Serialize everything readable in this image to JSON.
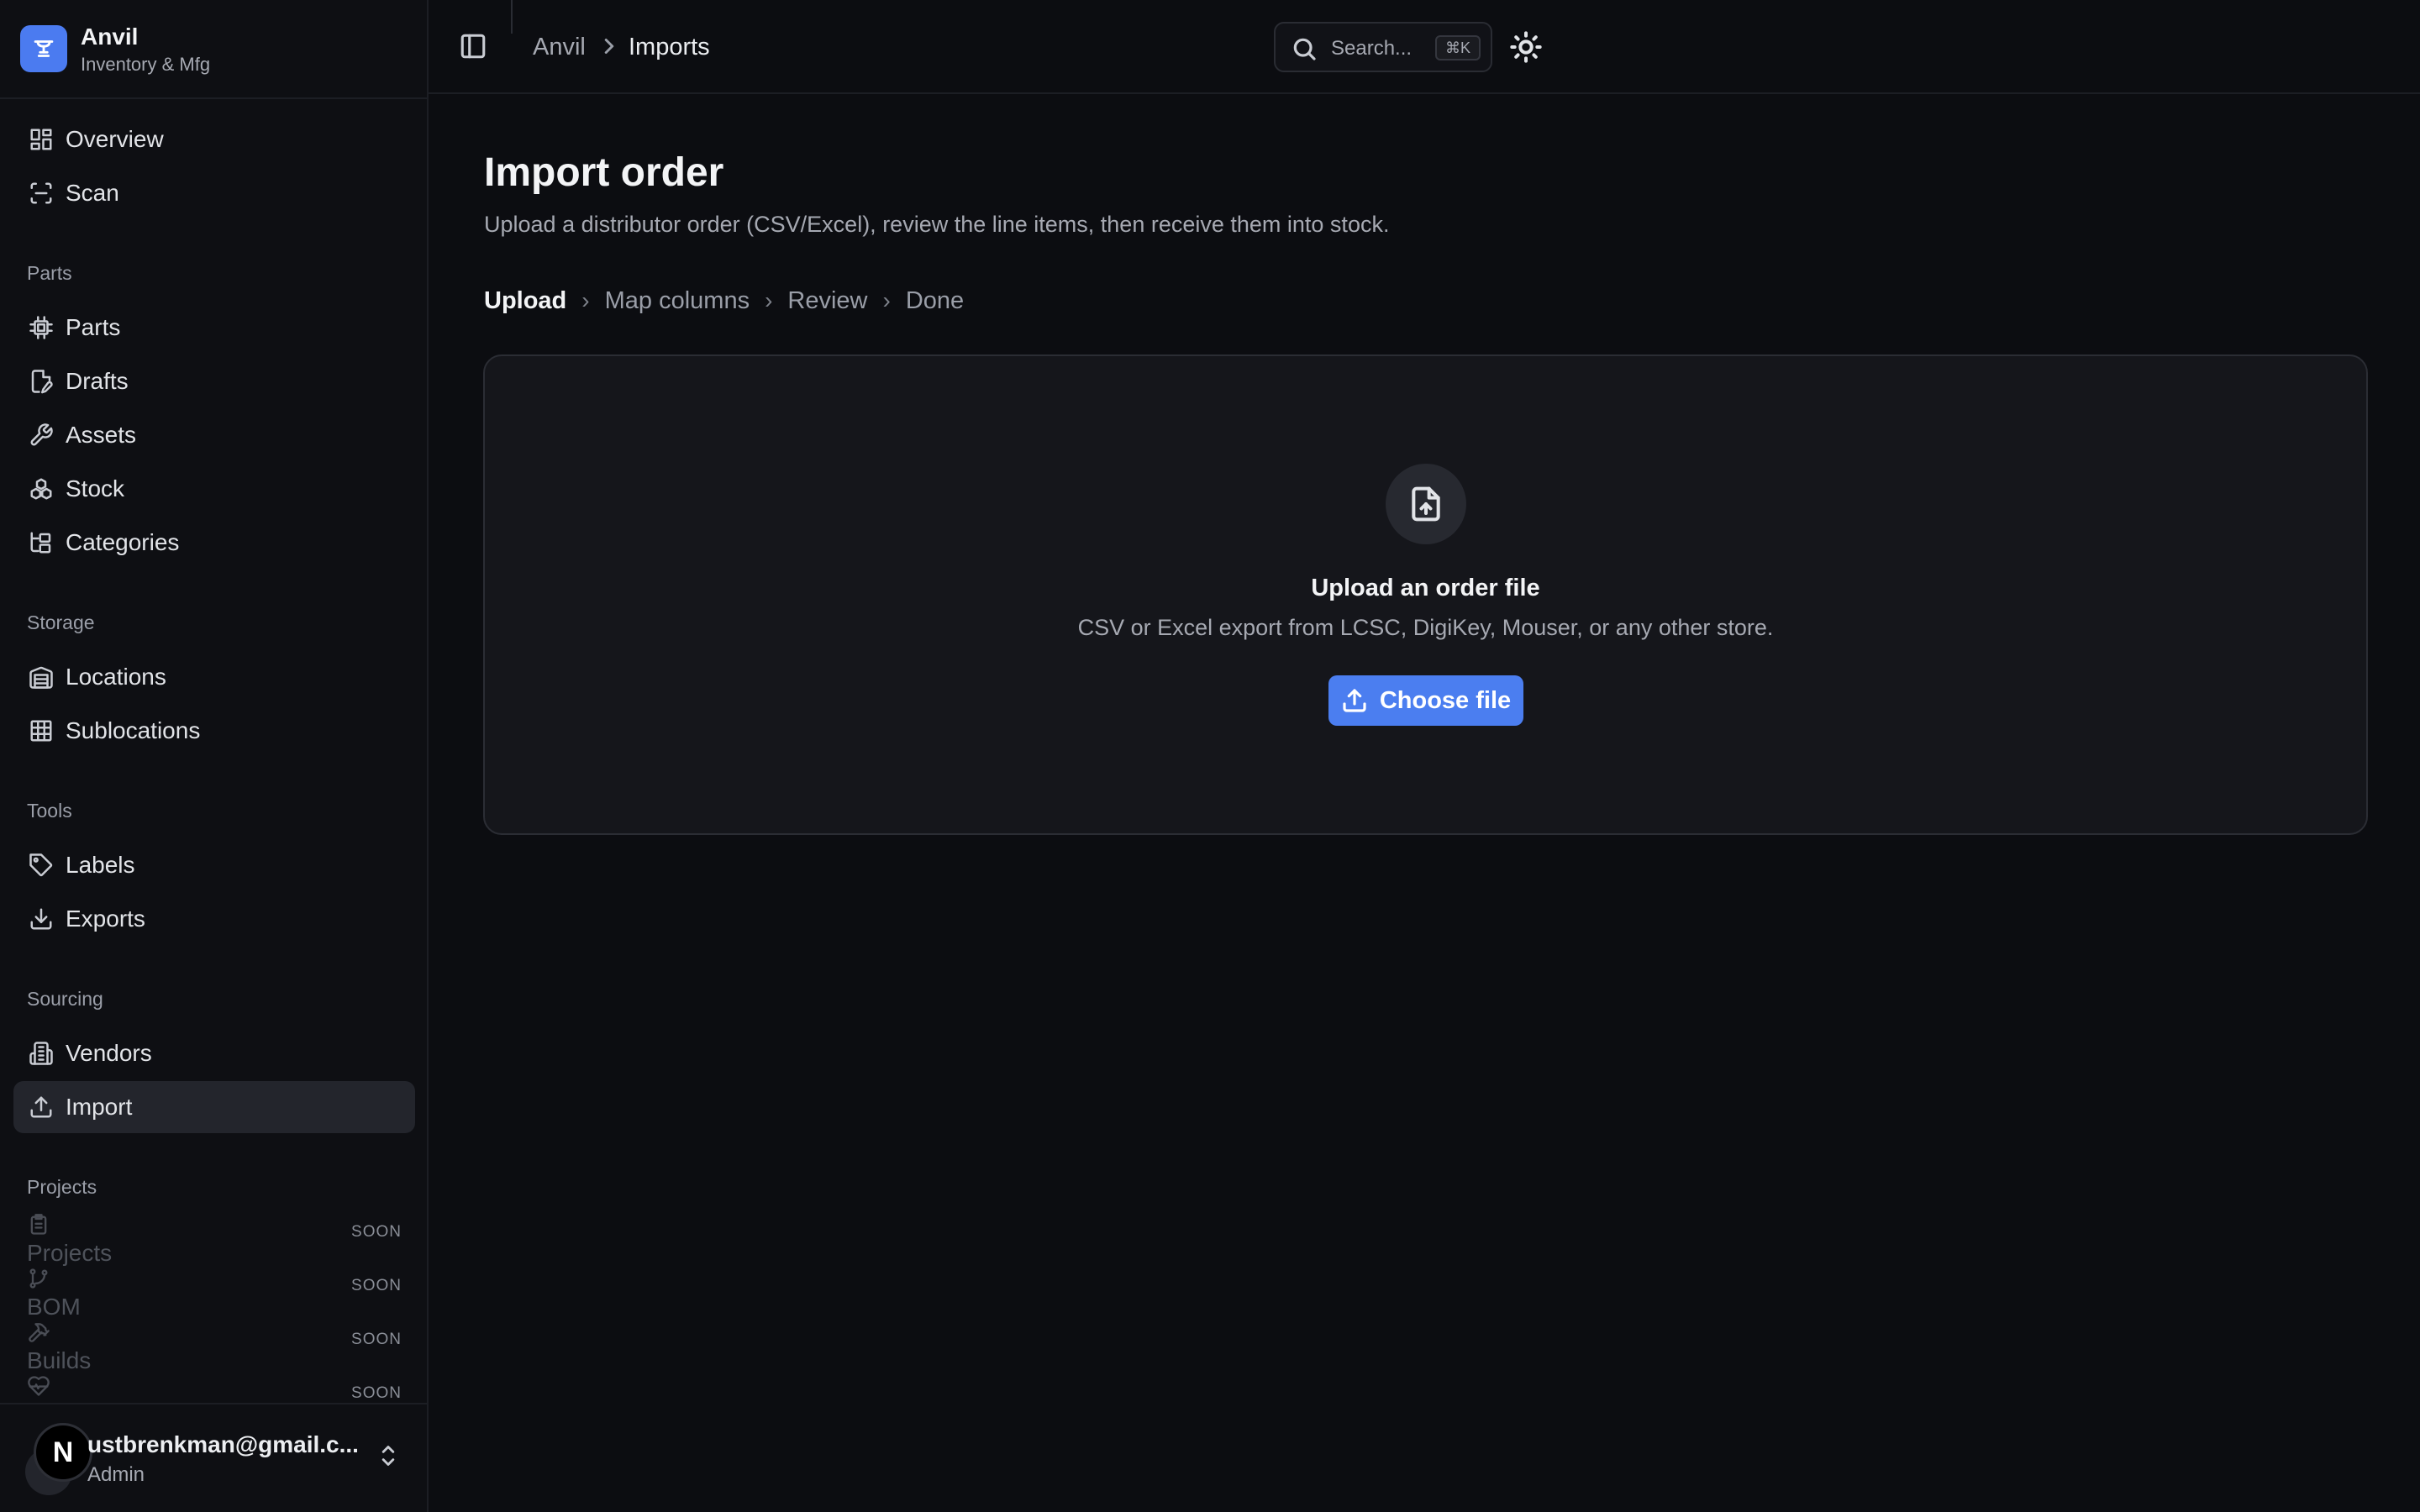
{
  "brand": {
    "name": "Anvil",
    "subtitle": "Inventory & Mfg",
    "icon": "anvil-icon"
  },
  "sidebar": {
    "top_items": [
      {
        "label": "Overview",
        "icon": "layout-dashboard-icon"
      },
      {
        "label": "Scan",
        "icon": "scan-icon"
      }
    ],
    "sections": [
      {
        "label": "Parts",
        "items": [
          {
            "label": "Parts",
            "icon": "chip-icon"
          },
          {
            "label": "Drafts",
            "icon": "file-edit-icon"
          },
          {
            "label": "Assets",
            "icon": "wrench-icon"
          },
          {
            "label": "Stock",
            "icon": "boxes-icon"
          },
          {
            "label": "Categories",
            "icon": "tree-icon"
          }
        ]
      },
      {
        "label": "Storage",
        "items": [
          {
            "label": "Locations",
            "icon": "warehouse-icon"
          },
          {
            "label": "Sublocations",
            "icon": "grid-icon"
          }
        ]
      },
      {
        "label": "Tools",
        "items": [
          {
            "label": "Labels",
            "icon": "tag-icon"
          },
          {
            "label": "Exports",
            "icon": "download-icon"
          }
        ]
      },
      {
        "label": "Sourcing",
        "items": [
          {
            "label": "Vendors",
            "icon": "building-icon"
          },
          {
            "label": "Import",
            "icon": "upload-icon",
            "active": true
          }
        ]
      },
      {
        "label": "Projects",
        "items": [
          {
            "label": "Projects",
            "icon": "clipboard-list-icon",
            "badge": "SOON"
          },
          {
            "label": "BOM",
            "icon": "git-branch-icon",
            "badge": "SOON"
          },
          {
            "label": "Builds",
            "icon": "hammer-icon",
            "badge": "SOON"
          },
          {
            "label": "",
            "icon": "heart-pulse-icon",
            "badge": "SOON"
          }
        ]
      }
    ]
  },
  "user": {
    "initial": "N",
    "email": "ustbrenkman@gmail.c...",
    "role": "Admin"
  },
  "topbar": {
    "breadcrumb": [
      "Anvil",
      "Imports"
    ],
    "search_placeholder": "Search...",
    "search_shortcut": "⌘K"
  },
  "main": {
    "title": "Import order",
    "subtitle": "Upload a distributor order (CSV/Excel), review the line items, then receive them into stock.",
    "steps": [
      "Upload",
      "Map columns",
      "Review",
      "Done"
    ],
    "current_step": "Upload",
    "dropzone": {
      "icon": "file-upload-icon",
      "title": "Upload an order file",
      "description": "CSV or Excel export from LCSC, DigiKey, Mouser, or any other store.",
      "button_label": "Choose file"
    }
  },
  "colors": {
    "accent": "#4b7ef0",
    "background": "#0c0d11",
    "active_nav": "#23252c"
  }
}
